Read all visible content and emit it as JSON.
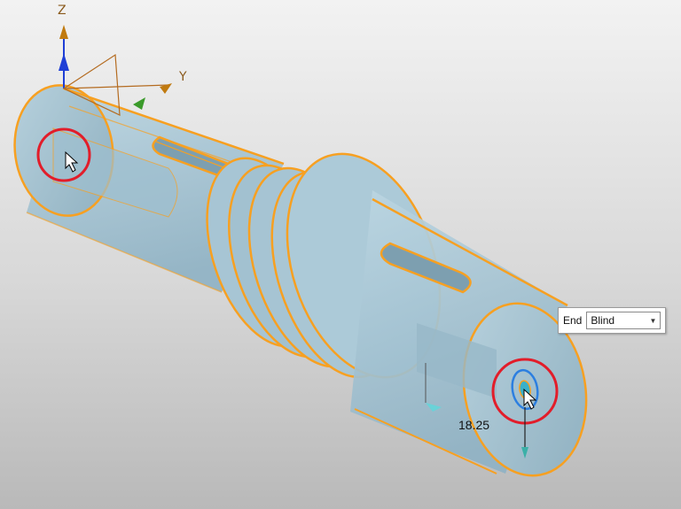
{
  "axes": {
    "z_label": "Z",
    "y_label": "Y"
  },
  "dimension": {
    "value": "18.25"
  },
  "end_condition": {
    "label": "End",
    "selected": "Blind"
  },
  "colors": {
    "edge": "#f7a021",
    "body_fill": "#a9c7d6",
    "highlight_circle": "#e21d2a",
    "selection": "#2c7fe0",
    "z_axis": "#1f3fd6",
    "y_axis": "#3a9a2a",
    "axis_tip": "#c07a10"
  },
  "icons": [
    "cursor-arrow-icon",
    "dropdown-caret-icon"
  ]
}
